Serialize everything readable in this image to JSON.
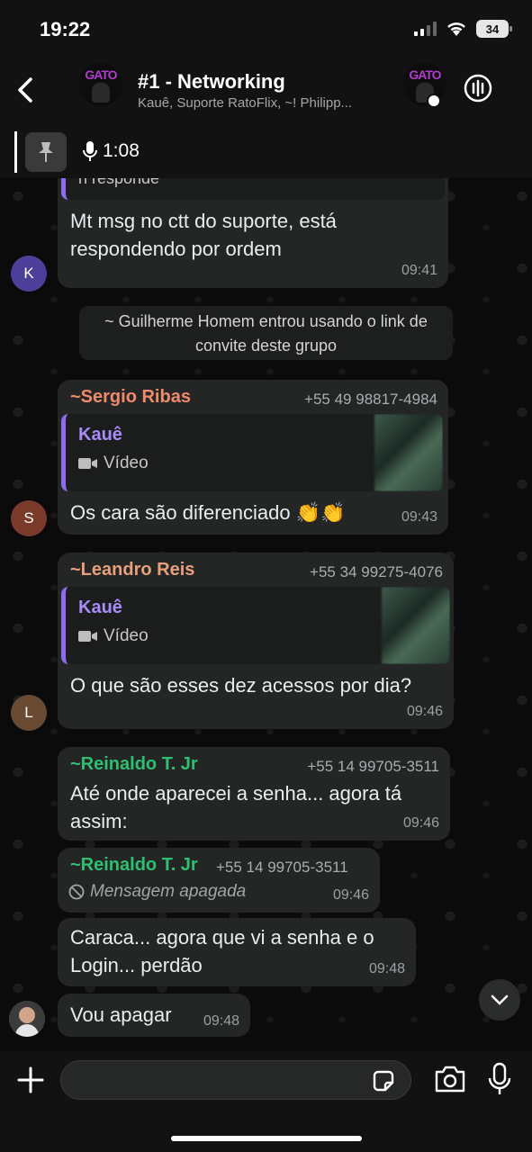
{
  "status_bar": {
    "time": "19:22",
    "battery": "34"
  },
  "header": {
    "title": "#1 - Networking",
    "subtitle": "Kauê, Suporte RatoFlix, ~! Philipp...",
    "avatar_text": "GATO"
  },
  "pinned": {
    "duration": "1:08"
  },
  "messages": {
    "m1": {
      "quote_tail": "n responde",
      "text": "Mt msg no ctt do suporte, está respondendo por ordem",
      "time": "09:41",
      "avatar": "K"
    },
    "system": {
      "text": "~ Guilherme Homem entrou usando o link de convite deste grupo"
    },
    "m2": {
      "sender": "~Sergio Ribas",
      "phone": "+55 49 98817-4984",
      "quote_name": "Kauê",
      "quote_type": "Vídeo",
      "text": "Os cara são diferenciado 👏👏",
      "time": "09:43",
      "avatar": "S"
    },
    "m3": {
      "sender": "~Leandro Reis",
      "phone": "+55 34 99275-4076",
      "quote_name": "Kauê",
      "quote_type": "Vídeo",
      "text": "O que são esses dez acessos por dia?",
      "time": "09:46",
      "avatar": "L"
    },
    "m4": {
      "sender": "~Reinaldo T. Jr",
      "phone": "+55 14 99705-3511",
      "text": "Até onde aparecei a senha... agora tá assim:",
      "time": "09:46"
    },
    "m5": {
      "sender": "~Reinaldo T. Jr",
      "phone": "+55 14 99705-3511",
      "text": "Mensagem apagada",
      "time": "09:46"
    },
    "m6": {
      "text": "Caraca... agora que vi a senha e o Login... perdão",
      "time": "09:48"
    },
    "m7": {
      "text": "Vou apagar",
      "time": "09:48"
    }
  },
  "colors": {
    "sergio": "#ef8a6a",
    "leandro": "#e8a07c",
    "reinaldo": "#2fbf71",
    "quote_accent": "#8e6cf0",
    "avatar_k": "#4b3f9a",
    "avatar_s": "#7a3a2a",
    "avatar_l": "#6b4a34"
  },
  "icons": [
    "back-arrow-icon",
    "group-call-icon",
    "pin-icon",
    "mic-icon",
    "video-icon",
    "deleted-icon",
    "chevron-down-icon",
    "plus-icon",
    "sticker-icon",
    "camera-icon"
  ]
}
